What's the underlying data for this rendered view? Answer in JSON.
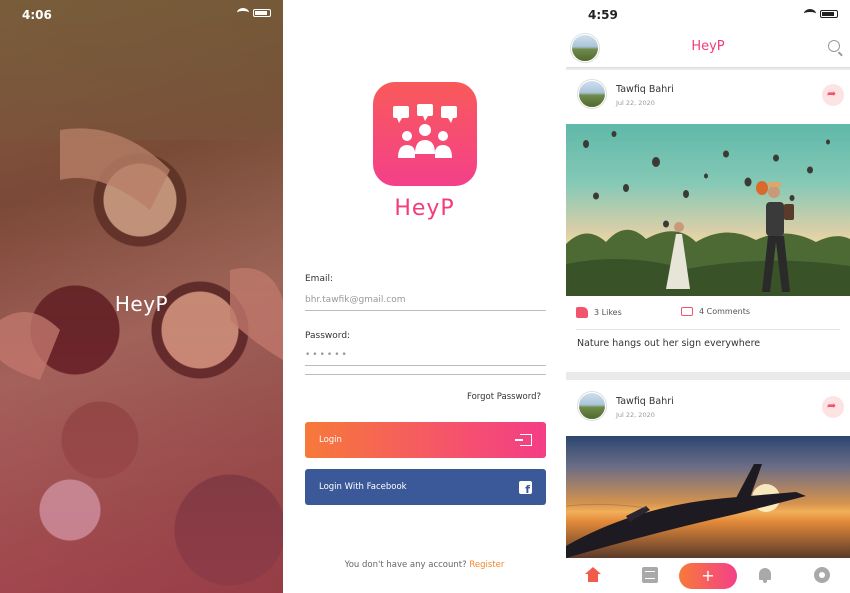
{
  "splash": {
    "status_time": "4:06",
    "title": "HeyP"
  },
  "login": {
    "logo_text": "HeyP",
    "email_label": "Email:",
    "email_value": "bhr.tawfik@gmail.com",
    "password_label": "Password:",
    "password_value": "••••••",
    "forgot_label": "Forgot Password?",
    "login_button": "Login",
    "facebook_button": "Login With Facebook",
    "no_account_text": "You don't have any account?",
    "register_link": "Register"
  },
  "feed": {
    "status_time": "4:59",
    "app_title": "HeyP",
    "posts": [
      {
        "author": "Tawfiq Bahri",
        "date": "Jul 22, 2020",
        "likes": "3 Likes",
        "comments": "4 Comments",
        "caption": "Nature hangs out her sign everywhere"
      },
      {
        "author": "Tawfiq Bahri",
        "date": "Jul 22, 2020"
      }
    ],
    "nav": {
      "add_label": "+"
    }
  },
  "colors": {
    "brand_pink": "#f43c7a",
    "brand_orange": "#f7793a",
    "facebook_blue": "#3b5998",
    "register_orange": "#f5862b"
  },
  "icons": [
    "wifi-icon",
    "battery-icon",
    "logo-people-icon",
    "login-icon",
    "facebook-icon",
    "search-icon",
    "share-icon",
    "like-icon",
    "comment-icon",
    "home-icon",
    "document-icon",
    "plus-icon",
    "bell-icon",
    "gear-icon"
  ]
}
